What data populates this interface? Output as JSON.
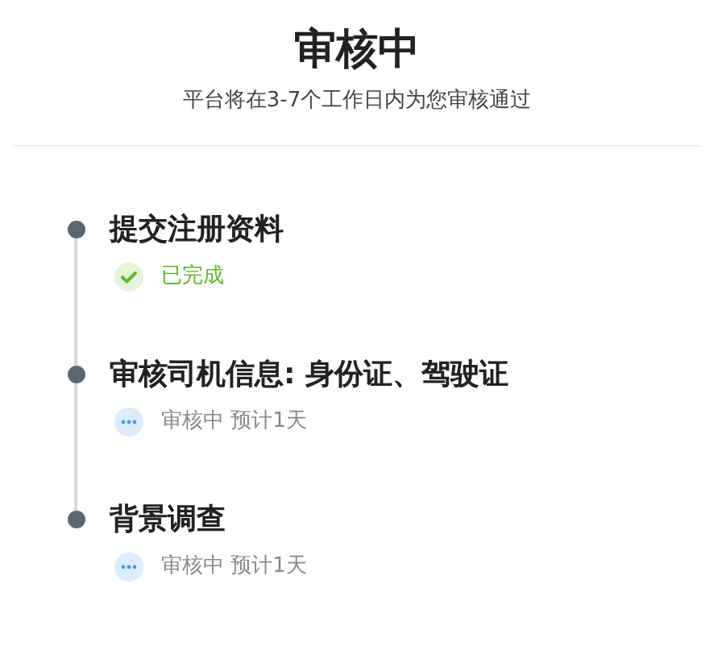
{
  "header": {
    "title": "审核中",
    "subtitle": "平台将在3-7个工作日内为您审核通过"
  },
  "steps": [
    {
      "title": "提交注册资料",
      "kind": "done",
      "status": "已完成"
    },
    {
      "title": "审核司机信息: 身份证、驾驶证",
      "kind": "pending",
      "status": "审核中 预计1天"
    },
    {
      "title": "背景调查",
      "kind": "pending",
      "status": "审核中 预计1天"
    }
  ]
}
